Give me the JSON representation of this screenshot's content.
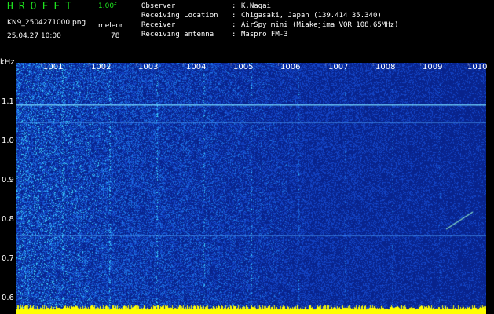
{
  "header": {
    "app_title": "HROFFT",
    "version": "1.00f",
    "file_name": "KN9_2504271000.png",
    "datetime": "25.04.27 10:00",
    "program": "meleor",
    "count": "78"
  },
  "info": [
    {
      "key": "Observer",
      "value": "K.Nagai"
    },
    {
      "key": "Receiving Location",
      "value": "Chigasaki, Japan (139.414 35.340)"
    },
    {
      "key": "Receiver",
      "value": "AirSpy mini (Miakejima VOR 108.65MHz)"
    },
    {
      "key": "Receiving antenna",
      "value": "Maspro FM-3"
    }
  ],
  "spectrogram": {
    "y_unit": "kHz",
    "y_ticks": [
      "1.1",
      "1.0",
      "0.9",
      "0.8",
      "0.7",
      "0.6"
    ],
    "x_ticks": [
      "1001",
      "1002",
      "1003",
      "1004",
      "1005",
      "1006",
      "1007",
      "1008",
      "1009",
      "1010"
    ],
    "colors": {
      "background": "#0a2a8a",
      "noise": "#1e5fd8",
      "bright": "#40c8ff",
      "hot": "#ffff00"
    }
  }
}
